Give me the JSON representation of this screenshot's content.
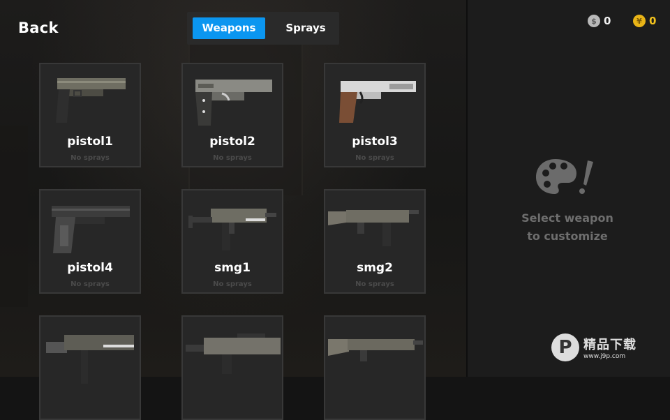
{
  "header": {
    "back_label": "Back",
    "tabs": [
      {
        "label": "Weapons",
        "active": true
      },
      {
        "label": "Sprays",
        "active": false
      }
    ]
  },
  "currency": {
    "silver": {
      "value": "0",
      "icon": "silver-coin-icon",
      "color": "#b9b9b9"
    },
    "gold": {
      "value": "0",
      "icon": "gold-coin-icon",
      "color": "#f2c21d"
    }
  },
  "accent_color": "#0b96f0",
  "weapons": [
    {
      "name": "pistol1",
      "sprays": "No sprays"
    },
    {
      "name": "pistol2",
      "sprays": "No sprays"
    },
    {
      "name": "pistol3",
      "sprays": "No sprays"
    },
    {
      "name": "pistol4",
      "sprays": "No sprays"
    },
    {
      "name": "smg1",
      "sprays": "No sprays"
    },
    {
      "name": "smg2",
      "sprays": "No sprays"
    },
    {
      "name": "",
      "sprays": ""
    },
    {
      "name": "",
      "sprays": ""
    },
    {
      "name": "",
      "sprays": ""
    }
  ],
  "side_panel": {
    "icon": "palette-icon",
    "hint_line1": "Select weapon",
    "hint_line2": "to customize"
  },
  "watermark": {
    "logo_letter": "P",
    "text": "精品下载",
    "url": "www.j9p.com"
  }
}
